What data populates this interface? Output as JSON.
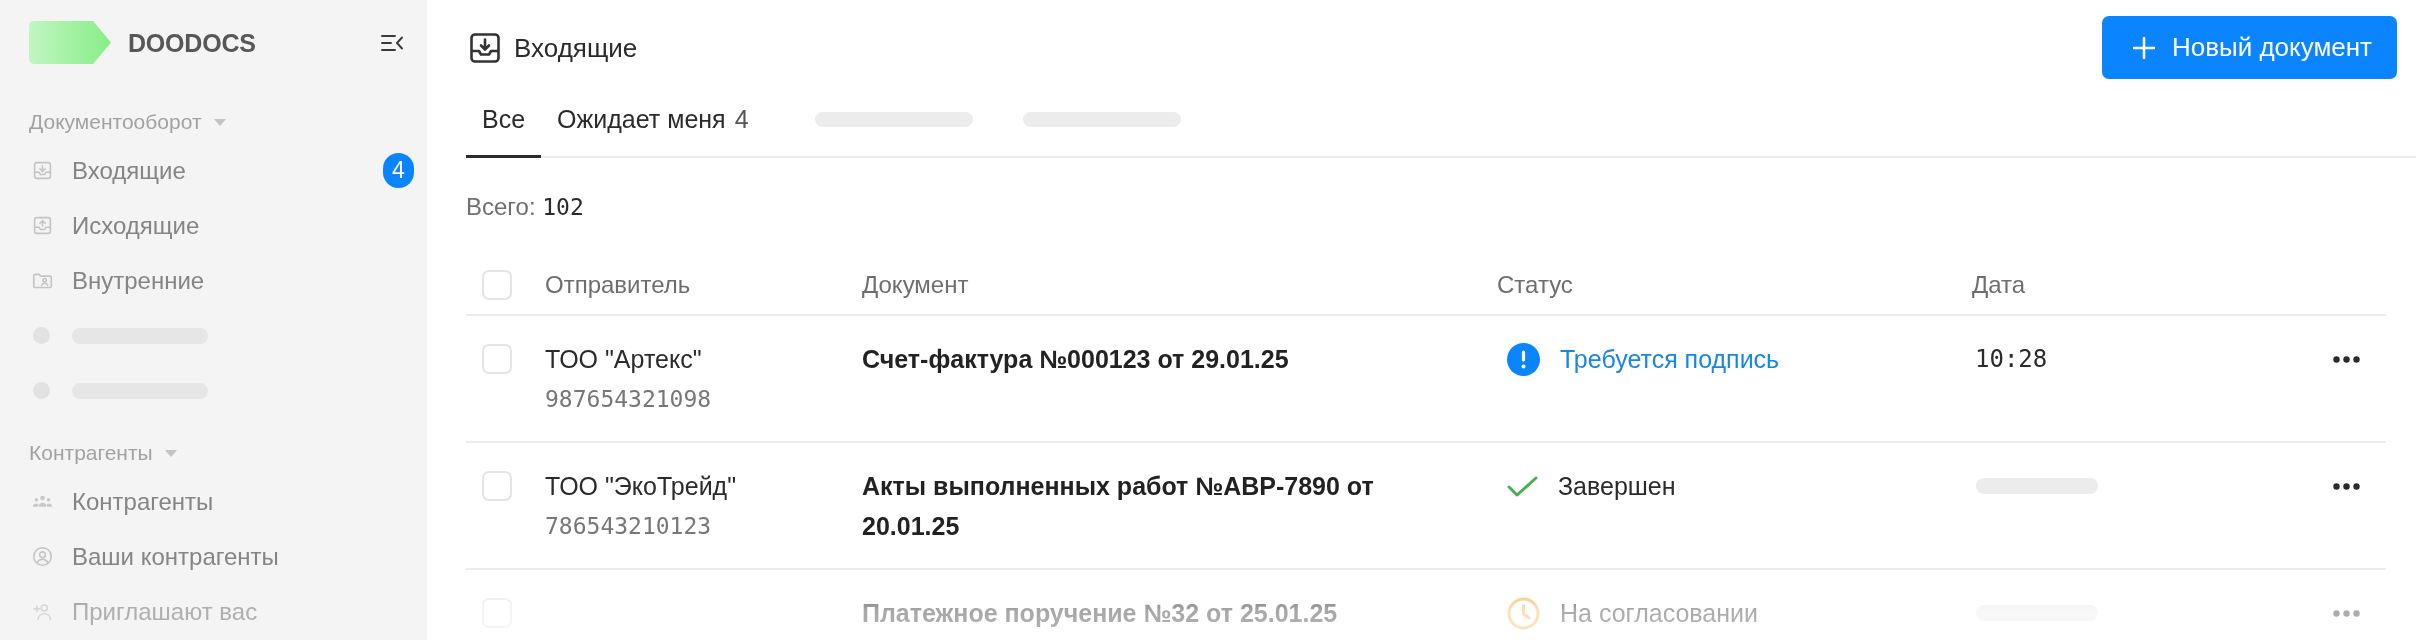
{
  "sidebar": {
    "logo": {
      "text": "DOODOCS"
    },
    "sections": [
      {
        "title": "Документооборот",
        "expanded": true,
        "items": [
          {
            "kind": "link",
            "label": "Входящие",
            "badge": "4"
          },
          {
            "kind": "link",
            "label": "Исходящие"
          },
          {
            "kind": "link",
            "label": "Внутренние"
          },
          {
            "kind": "skeleton"
          },
          {
            "kind": "skeleton"
          }
        ]
      },
      {
        "title": "Контрагенты",
        "expanded": true,
        "items": [
          {
            "kind": "link",
            "label": "Контрагенты"
          },
          {
            "kind": "link",
            "label": "Ваши контрагенты"
          },
          {
            "kind": "link",
            "label": "Приглашают вас"
          }
        ]
      }
    ]
  },
  "header": {
    "title": "Входящие",
    "new_button": {
      "label": "Новый документ"
    }
  },
  "tabs": [
    {
      "kind": "tab",
      "label": "Все",
      "selected": true
    },
    {
      "kind": "tab",
      "label": "Ожидает меня",
      "count": "4",
      "selected": false
    },
    {
      "kind": "skeleton",
      "selected": false
    },
    {
      "kind": "skeleton",
      "selected": false
    }
  ],
  "total": {
    "label": "Всего:",
    "value": "102"
  },
  "table": {
    "select_all": {
      "checked": false
    },
    "columns": [
      {
        "label": "Отправитель"
      },
      {
        "label": "Документ"
      },
      {
        "label": "Статус"
      },
      {
        "label": "Дата"
      }
    ],
    "rows": [
      {
        "checked": false,
        "sender": "ТОО \"Артекс\"",
        "sender_id": "987654321098",
        "document": "Счет-фактура №000123 от 29.01.25",
        "status": {
          "kind": "alert",
          "label": "Требуется подпись"
        },
        "date": "10:28"
      },
      {
        "checked": false,
        "sender": "ТОО \"ЭкоТрейд\"",
        "sender_id": "786543210123",
        "document": "Акты выполненных работ №АВР-7890 от 20.01.25",
        "status": {
          "kind": "done",
          "label": "Завершен"
        }
      },
      {
        "checked": false,
        "document": "Платежное поручение №32 от 25.01.25",
        "status": {
          "kind": "pending",
          "label": "На согласовании"
        }
      }
    ]
  }
}
